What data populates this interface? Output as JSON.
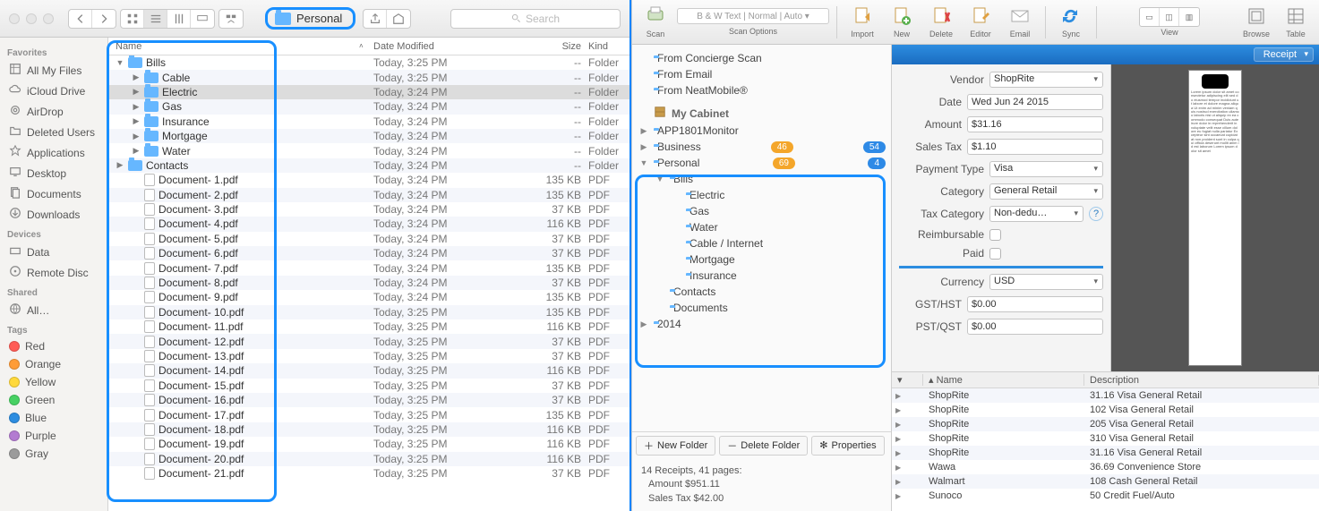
{
  "finder": {
    "title_folder": "Personal",
    "search_placeholder": "Search",
    "sidebar": {
      "sections": [
        {
          "header": "Favorites",
          "items": [
            {
              "icon": "allfiles",
              "label": "All My Files"
            },
            {
              "icon": "cloud",
              "label": "iCloud Drive"
            },
            {
              "icon": "airdrop",
              "label": "AirDrop"
            },
            {
              "icon": "folder",
              "label": "Deleted Users"
            },
            {
              "icon": "apps",
              "label": "Applications"
            },
            {
              "icon": "desktop",
              "label": "Desktop"
            },
            {
              "icon": "docs",
              "label": "Documents"
            },
            {
              "icon": "downloads",
              "label": "Downloads"
            }
          ]
        },
        {
          "header": "Devices",
          "items": [
            {
              "icon": "drive",
              "label": "Data"
            },
            {
              "icon": "disc",
              "label": "Remote Disc"
            }
          ]
        },
        {
          "header": "Shared",
          "items": [
            {
              "icon": "globe",
              "label": "All…"
            }
          ]
        },
        {
          "header": "Tags",
          "items": [
            {
              "tag": "#ff5b55",
              "label": "Red"
            },
            {
              "tag": "#ff9c37",
              "label": "Orange"
            },
            {
              "tag": "#ffd93b",
              "label": "Yellow"
            },
            {
              "tag": "#47d163",
              "label": "Green"
            },
            {
              "tag": "#2d8de0",
              "label": "Blue"
            },
            {
              "tag": "#b37bd1",
              "label": "Purple"
            },
            {
              "tag": "#9b9b9b",
              "label": "Gray"
            }
          ]
        }
      ]
    },
    "columns": {
      "name": "Name",
      "date": "Date Modified",
      "size": "Size",
      "kind": "Kind"
    },
    "rows": [
      {
        "depth": 0,
        "type": "folder",
        "open": true,
        "name": "Bills",
        "date": "Today, 3:25 PM",
        "size": "--",
        "kind": "Folder"
      },
      {
        "depth": 1,
        "type": "folder",
        "name": "Cable",
        "date": "Today, 3:25 PM",
        "size": "--",
        "kind": "Folder"
      },
      {
        "depth": 1,
        "type": "folder",
        "name": "Electric",
        "date": "Today, 3:24 PM",
        "size": "--",
        "kind": "Folder",
        "sel": true
      },
      {
        "depth": 1,
        "type": "folder",
        "name": "Gas",
        "date": "Today, 3:24 PM",
        "size": "--",
        "kind": "Folder"
      },
      {
        "depth": 1,
        "type": "folder",
        "name": "Insurance",
        "date": "Today, 3:24 PM",
        "size": "--",
        "kind": "Folder"
      },
      {
        "depth": 1,
        "type": "folder",
        "name": "Mortgage",
        "date": "Today, 3:24 PM",
        "size": "--",
        "kind": "Folder"
      },
      {
        "depth": 1,
        "type": "folder",
        "name": "Water",
        "date": "Today, 3:24 PM",
        "size": "--",
        "kind": "Folder"
      },
      {
        "depth": 0,
        "type": "folder",
        "name": "Contacts",
        "date": "Today, 3:24 PM",
        "size": "--",
        "kind": "Folder"
      },
      {
        "depth": 1,
        "type": "file",
        "name": "Document- 1.pdf",
        "date": "Today, 3:24 PM",
        "size": "135 KB",
        "kind": "PDF"
      },
      {
        "depth": 1,
        "type": "file",
        "name": "Document- 2.pdf",
        "date": "Today, 3:24 PM",
        "size": "135 KB",
        "kind": "PDF"
      },
      {
        "depth": 1,
        "type": "file",
        "name": "Document- 3.pdf",
        "date": "Today, 3:24 PM",
        "size": "37 KB",
        "kind": "PDF"
      },
      {
        "depth": 1,
        "type": "file",
        "name": "Document- 4.pdf",
        "date": "Today, 3:24 PM",
        "size": "116 KB",
        "kind": "PDF"
      },
      {
        "depth": 1,
        "type": "file",
        "name": "Document- 5.pdf",
        "date": "Today, 3:24 PM",
        "size": "37 KB",
        "kind": "PDF"
      },
      {
        "depth": 1,
        "type": "file",
        "name": "Document- 6.pdf",
        "date": "Today, 3:24 PM",
        "size": "37 KB",
        "kind": "PDF"
      },
      {
        "depth": 1,
        "type": "file",
        "name": "Document- 7.pdf",
        "date": "Today, 3:24 PM",
        "size": "135 KB",
        "kind": "PDF"
      },
      {
        "depth": 1,
        "type": "file",
        "name": "Document- 8.pdf",
        "date": "Today, 3:24 PM",
        "size": "37 KB",
        "kind": "PDF"
      },
      {
        "depth": 1,
        "type": "file",
        "name": "Document- 9.pdf",
        "date": "Today, 3:24 PM",
        "size": "135 KB",
        "kind": "PDF"
      },
      {
        "depth": 1,
        "type": "file",
        "name": "Document- 10.pdf",
        "date": "Today, 3:25 PM",
        "size": "135 KB",
        "kind": "PDF"
      },
      {
        "depth": 1,
        "type": "file",
        "name": "Document- 11.pdf",
        "date": "Today, 3:25 PM",
        "size": "116 KB",
        "kind": "PDF"
      },
      {
        "depth": 1,
        "type": "file",
        "name": "Document- 12.pdf",
        "date": "Today, 3:25 PM",
        "size": "37 KB",
        "kind": "PDF"
      },
      {
        "depth": 1,
        "type": "file",
        "name": "Document- 13.pdf",
        "date": "Today, 3:25 PM",
        "size": "37 KB",
        "kind": "PDF"
      },
      {
        "depth": 1,
        "type": "file",
        "name": "Document- 14.pdf",
        "date": "Today, 3:25 PM",
        "size": "116 KB",
        "kind": "PDF"
      },
      {
        "depth": 1,
        "type": "file",
        "name": "Document- 15.pdf",
        "date": "Today, 3:25 PM",
        "size": "37 KB",
        "kind": "PDF"
      },
      {
        "depth": 1,
        "type": "file",
        "name": "Document- 16.pdf",
        "date": "Today, 3:25 PM",
        "size": "37 KB",
        "kind": "PDF"
      },
      {
        "depth": 1,
        "type": "file",
        "name": "Document- 17.pdf",
        "date": "Today, 3:25 PM",
        "size": "135 KB",
        "kind": "PDF"
      },
      {
        "depth": 1,
        "type": "file",
        "name": "Document- 18.pdf",
        "date": "Today, 3:25 PM",
        "size": "116 KB",
        "kind": "PDF"
      },
      {
        "depth": 1,
        "type": "file",
        "name": "Document- 19.pdf",
        "date": "Today, 3:25 PM",
        "size": "116 KB",
        "kind": "PDF"
      },
      {
        "depth": 1,
        "type": "file",
        "name": "Document- 20.pdf",
        "date": "Today, 3:25 PM",
        "size": "116 KB",
        "kind": "PDF"
      },
      {
        "depth": 1,
        "type": "file",
        "name": "Document- 21.pdf",
        "date": "Today, 3:25 PM",
        "size": "37 KB",
        "kind": "PDF"
      }
    ]
  },
  "neat": {
    "toolbar": [
      {
        "name": "scan",
        "label": "Scan"
      },
      {
        "name": "scanopts",
        "label": "Scan Options",
        "combo": "B & W Text | Normal | Auto"
      },
      {
        "name": "import",
        "label": "Import"
      },
      {
        "name": "new",
        "label": "New"
      },
      {
        "name": "delete",
        "label": "Delete"
      },
      {
        "name": "editor",
        "label": "Editor"
      },
      {
        "name": "email",
        "label": "Email"
      },
      {
        "name": "sync",
        "label": "Sync"
      },
      {
        "name": "view",
        "label": "View"
      },
      {
        "name": "browse",
        "label": "Browse"
      },
      {
        "name": "table",
        "label": "Table"
      }
    ],
    "tree": [
      {
        "d": 0,
        "icon": "folder",
        "label": "From Concierge Scan"
      },
      {
        "d": 0,
        "icon": "folder",
        "label": "From Email"
      },
      {
        "d": 0,
        "icon": "folder",
        "label": "From NeatMobile®"
      },
      {
        "d": 0,
        "hdr": true,
        "icon": "cabinet",
        "label": "My Cabinet"
      },
      {
        "d": 0,
        "dis": "▶",
        "icon": "folder",
        "label": "APP1801Monitor"
      },
      {
        "d": 0,
        "dis": "▶",
        "icon": "folder",
        "label": "Business",
        "b1": "46",
        "b2": "54"
      },
      {
        "d": 0,
        "dis": "▼",
        "icon": "folder",
        "label": "Personal",
        "b1": "69",
        "b2": "4"
      },
      {
        "d": 1,
        "dis": "▼",
        "icon": "folder",
        "label": "Bills"
      },
      {
        "d": 2,
        "icon": "folder",
        "label": "Electric"
      },
      {
        "d": 2,
        "icon": "folder",
        "label": "Gas"
      },
      {
        "d": 2,
        "icon": "folder",
        "label": "Water"
      },
      {
        "d": 2,
        "icon": "folder",
        "label": "Cable / Internet"
      },
      {
        "d": 2,
        "icon": "folder",
        "label": "Mortgage"
      },
      {
        "d": 2,
        "icon": "folder",
        "label": "Insurance"
      },
      {
        "d": 1,
        "icon": "folder",
        "label": "Contacts"
      },
      {
        "d": 1,
        "icon": "folder",
        "label": "Documents"
      },
      {
        "d": 0,
        "dis": "▶",
        "icon": "folder",
        "label": "2014"
      }
    ],
    "footer": {
      "new": "New Folder",
      "del": "Delete Folder",
      "props": "Properties"
    },
    "stats": {
      "l1": "14 Receipts, 41 pages:",
      "l2": "Amount $951.11",
      "l3": "Sales Tax $42.00"
    },
    "detail": {
      "type": "Receipt",
      "fields": [
        {
          "label": "Vendor",
          "type": "sel",
          "value": "ShopRite"
        },
        {
          "label": "Date",
          "type": "inp",
          "value": "Wed Jun 24 2015"
        },
        {
          "label": "Amount",
          "type": "inp",
          "value": "$31.16"
        },
        {
          "label": "Sales Tax",
          "type": "inp",
          "value": "$1.10"
        },
        {
          "label": "Payment Type",
          "type": "sel",
          "value": "Visa"
        },
        {
          "label": "Category",
          "type": "sel",
          "value": "General Retail"
        },
        {
          "label": "Tax Category",
          "type": "sel",
          "value": "Non-dedu…",
          "help": true
        },
        {
          "label": "Reimbursable",
          "type": "chk"
        },
        {
          "label": "Paid",
          "type": "chk"
        },
        {
          "sep": true
        },
        {
          "label": "Currency",
          "type": "sel",
          "value": "USD"
        },
        {
          "label": "GST/HST",
          "type": "inp",
          "value": "$0.00"
        },
        {
          "label": "PST/QST",
          "type": "inp",
          "value": "$0.00"
        }
      ]
    },
    "table": {
      "cols": [
        "",
        "Name",
        "Description"
      ],
      "rows": [
        {
          "name": "ShopRite",
          "desc": "31.16 Visa General Retail"
        },
        {
          "name": "ShopRite",
          "desc": "102 Visa General Retail"
        },
        {
          "name": "ShopRite",
          "desc": "205 Visa General Retail"
        },
        {
          "name": "ShopRite",
          "desc": "310 Visa General Retail"
        },
        {
          "name": "ShopRite",
          "desc": "31.16 Visa General Retail"
        },
        {
          "name": "Wawa",
          "desc": "36.69 Convenience Store"
        },
        {
          "name": "Walmart",
          "desc": "108 Cash General Retail"
        },
        {
          "name": "Sunoco",
          "desc": "50 Credit Fuel/Auto"
        }
      ]
    }
  }
}
